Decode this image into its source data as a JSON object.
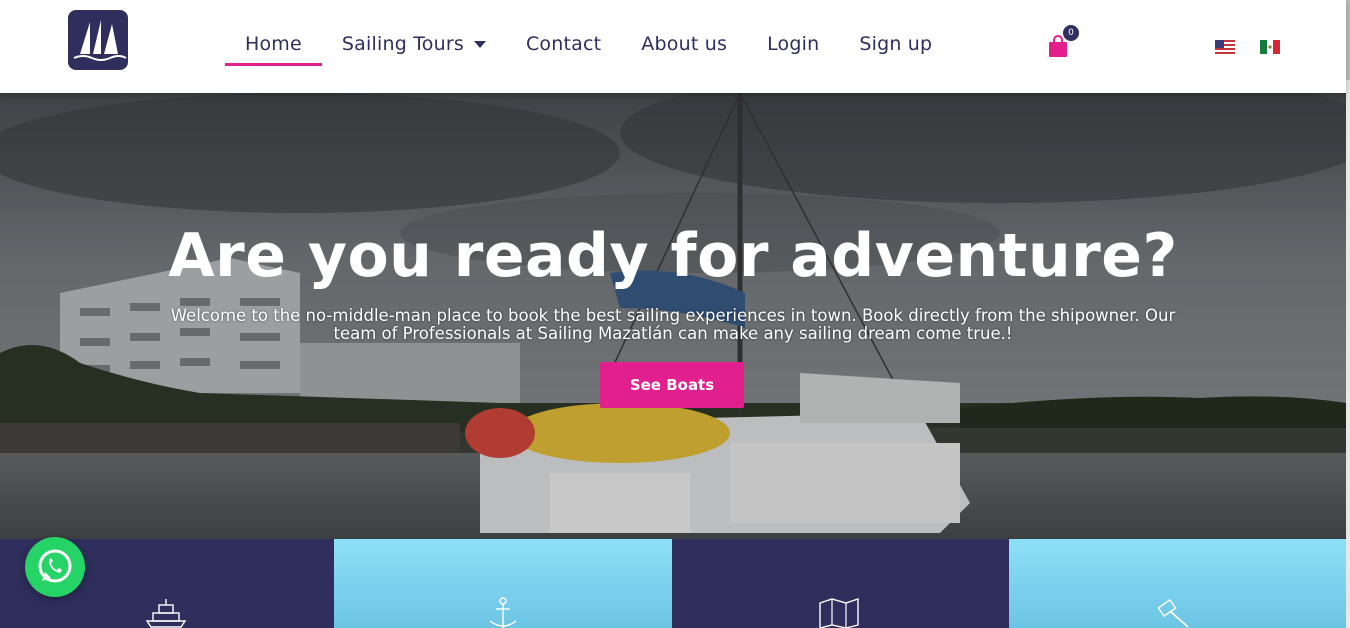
{
  "header": {
    "nav": [
      {
        "label": "Home",
        "active": true
      },
      {
        "label": "Sailing Tours",
        "has_dropdown": true
      },
      {
        "label": "Contact"
      },
      {
        "label": "About us"
      },
      {
        "label": "Login"
      },
      {
        "label": "Sign up"
      }
    ],
    "cart": {
      "icon": "shopping-bag-icon",
      "count": "0"
    },
    "languages": [
      {
        "icon": "us-flag-icon",
        "code": "en"
      },
      {
        "icon": "mx-flag-icon",
        "code": "es"
      }
    ]
  },
  "hero": {
    "title": "Are you ready for adventure?",
    "subtitle": "Welcome to the no-middle-man place to book the best sailing experiences in town. Book directly from the shipowner. Our team of Professionals at Sailing Mazatlán can make any sailing dream come true.!",
    "cta_label": "See Boats"
  },
  "features": [
    {
      "icon": "yacht-icon",
      "theme": "dark"
    },
    {
      "icon": "anchor-icon",
      "theme": "light"
    },
    {
      "icon": "map-icon",
      "theme": "dark"
    },
    {
      "icon": "hammer-icon",
      "theme": "light"
    }
  ],
  "colors": {
    "brand_navy": "#2f2e5c",
    "accent_pink": "#e1208e",
    "light_blue": "#8ee0f8",
    "whatsapp_green": "#25d366"
  }
}
